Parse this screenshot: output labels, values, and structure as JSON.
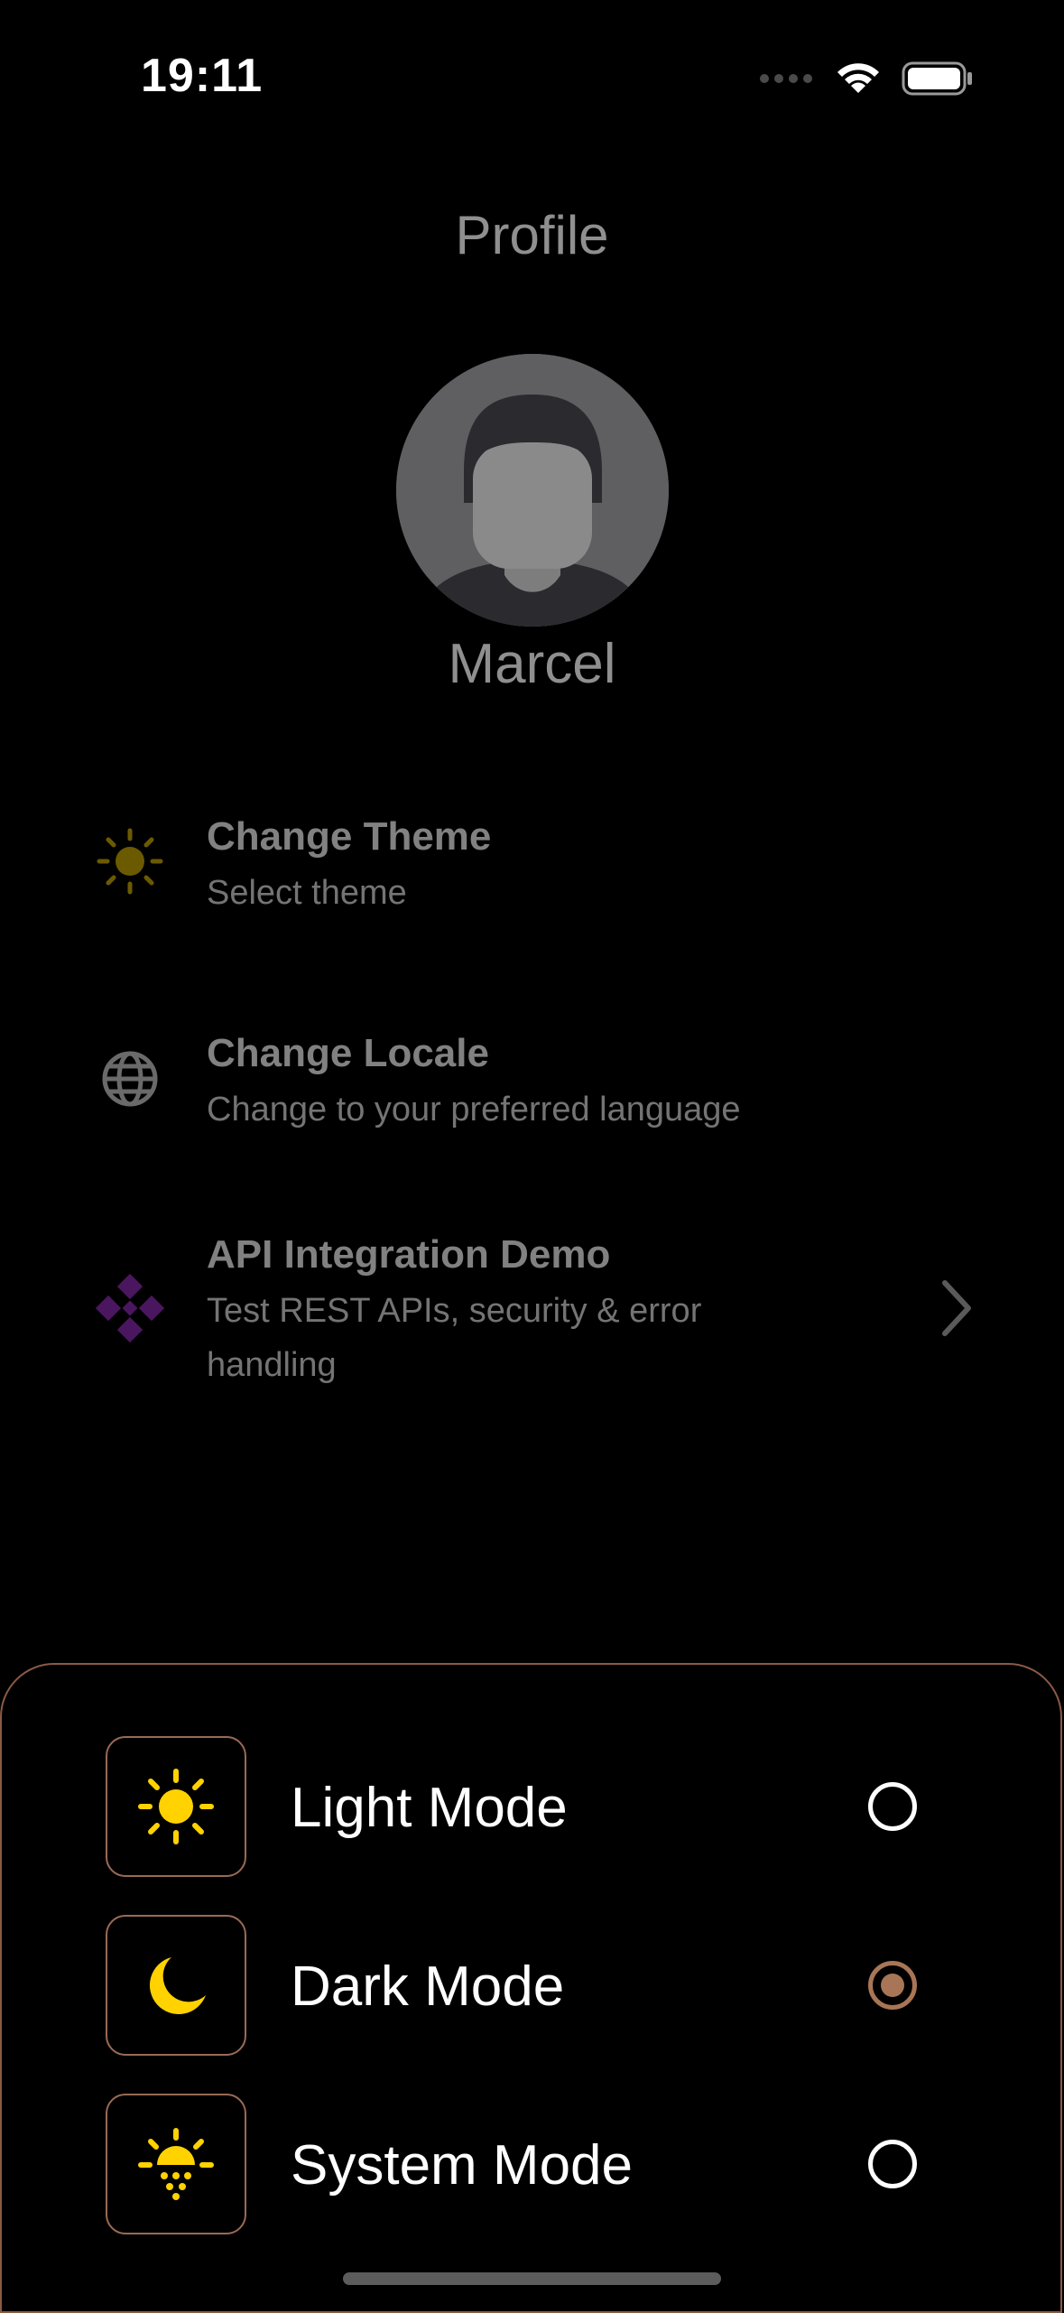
{
  "status_bar": {
    "time": "19:11"
  },
  "header": {
    "title": "Profile"
  },
  "profile": {
    "name": "Marcel"
  },
  "menu": [
    {
      "title": "Change Theme",
      "subtitle": "Select theme",
      "icon": "sun-icon",
      "icon_color": "#6b5a00"
    },
    {
      "title": "Change Locale",
      "subtitle": "Change to your preferred language",
      "icon": "globe-icon",
      "icon_color": "#6a6a6a"
    },
    {
      "title": "API Integration Demo",
      "subtitle": "Test REST APIs, security & error handling",
      "icon": "api-icon",
      "icon_color": "#4b1660"
    }
  ],
  "theme_sheet": {
    "options": [
      {
        "label": "Light Mode",
        "icon": "sun-icon",
        "selected": false
      },
      {
        "label": "Dark Mode",
        "icon": "moon-icon",
        "selected": true
      },
      {
        "label": "System Mode",
        "icon": "sunrise-icon",
        "selected": false
      }
    ],
    "accent_color": "#a87556",
    "icon_color": "#ffd200"
  }
}
